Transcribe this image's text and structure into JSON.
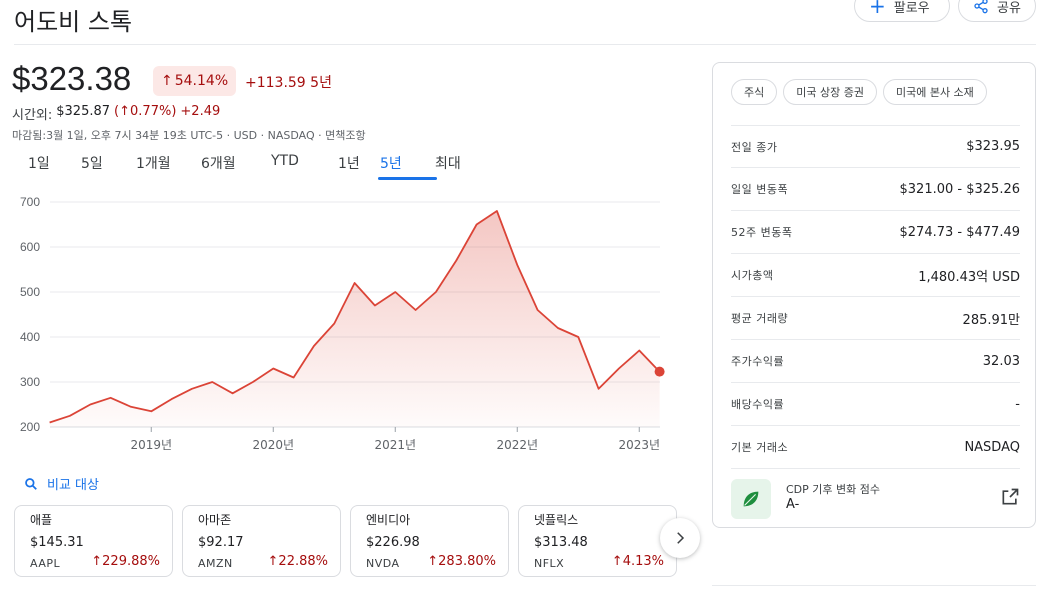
{
  "header": {
    "title": "어도비 스톡",
    "follow_label": "팔로우",
    "share_label": "공유"
  },
  "quote": {
    "price": "$323.38",
    "change_pct": "54.14%",
    "change_abs": "+113.59 5년",
    "after_hours_label": "시간외:",
    "after_hours_price": "$325.87",
    "after_hours_pct": "0.77%",
    "after_hours_abs": "+2.49",
    "meta": "마감됨:3월 1일, 오후 7시 34분 19초 UTC-5 · USD · NASDAQ · 면책조항"
  },
  "ranges": [
    "1일",
    "5일",
    "1개월",
    "6개월",
    "YTD",
    "1년",
    "5년",
    "최대"
  ],
  "active_range": "5년",
  "colors": {
    "down": "#a50e0e",
    "accent": "#1a73e8",
    "line": "#db4437"
  },
  "chart_data": {
    "type": "area",
    "x": [
      "2018-03",
      "2018-05",
      "2018-07",
      "2018-09",
      "2018-11",
      "2019-01",
      "2019-03",
      "2019-05",
      "2019-07",
      "2019-09",
      "2019-11",
      "2020-01",
      "2020-03",
      "2020-05",
      "2020-07",
      "2020-09",
      "2020-11",
      "2021-01",
      "2021-03",
      "2021-05",
      "2021-07",
      "2021-09",
      "2021-11",
      "2022-01",
      "2022-03",
      "2022-05",
      "2022-07",
      "2022-09",
      "2022-11",
      "2023-01",
      "2023-03"
    ],
    "values": [
      210,
      225,
      250,
      265,
      245,
      235,
      262,
      285,
      300,
      275,
      300,
      330,
      310,
      380,
      430,
      520,
      470,
      500,
      460,
      500,
      570,
      650,
      680,
      560,
      460,
      420,
      400,
      285,
      330,
      370,
      323
    ],
    "yticks": [
      200,
      300,
      400,
      500,
      600,
      700
    ],
    "xticks": [
      "2019년",
      "2020년",
      "2021년",
      "2022년",
      "2023년"
    ],
    "ylim": [
      200,
      700
    ],
    "grid": true
  },
  "compare_label": "비교 대상",
  "peers": [
    {
      "name": "애플",
      "price": "$145.31",
      "ticker": "AAPL",
      "change": "229.88%"
    },
    {
      "name": "아마존",
      "price": "$92.17",
      "ticker": "AMZN",
      "change": "22.88%"
    },
    {
      "name": "엔비디아",
      "price": "$226.98",
      "ticker": "NVDA",
      "change": "283.80%"
    },
    {
      "name": "넷플릭스",
      "price": "$313.48",
      "ticker": "NFLX",
      "change": "4.13%"
    }
  ],
  "panel": {
    "chips": [
      "주식",
      "미국 상장 증권",
      "미국에 본사 소재"
    ],
    "stats": [
      {
        "label": "전일 종가",
        "value": "$323.95"
      },
      {
        "label": "일일 변동폭",
        "value": "$321.00 - $325.26"
      },
      {
        "label": "52주 변동폭",
        "value": "$274.73 - $477.49"
      },
      {
        "label": "시가총액",
        "value": "1,480.43억 USD"
      },
      {
        "label": "평균 거래량",
        "value": "285.91만"
      },
      {
        "label": "주가수익률",
        "value": "32.03"
      },
      {
        "label": "배당수익률",
        "value": "-"
      },
      {
        "label": "기본 거래소",
        "value": "NASDAQ"
      }
    ],
    "cdp_label": "CDP 기후 변화 점수",
    "cdp_score": "A-"
  }
}
